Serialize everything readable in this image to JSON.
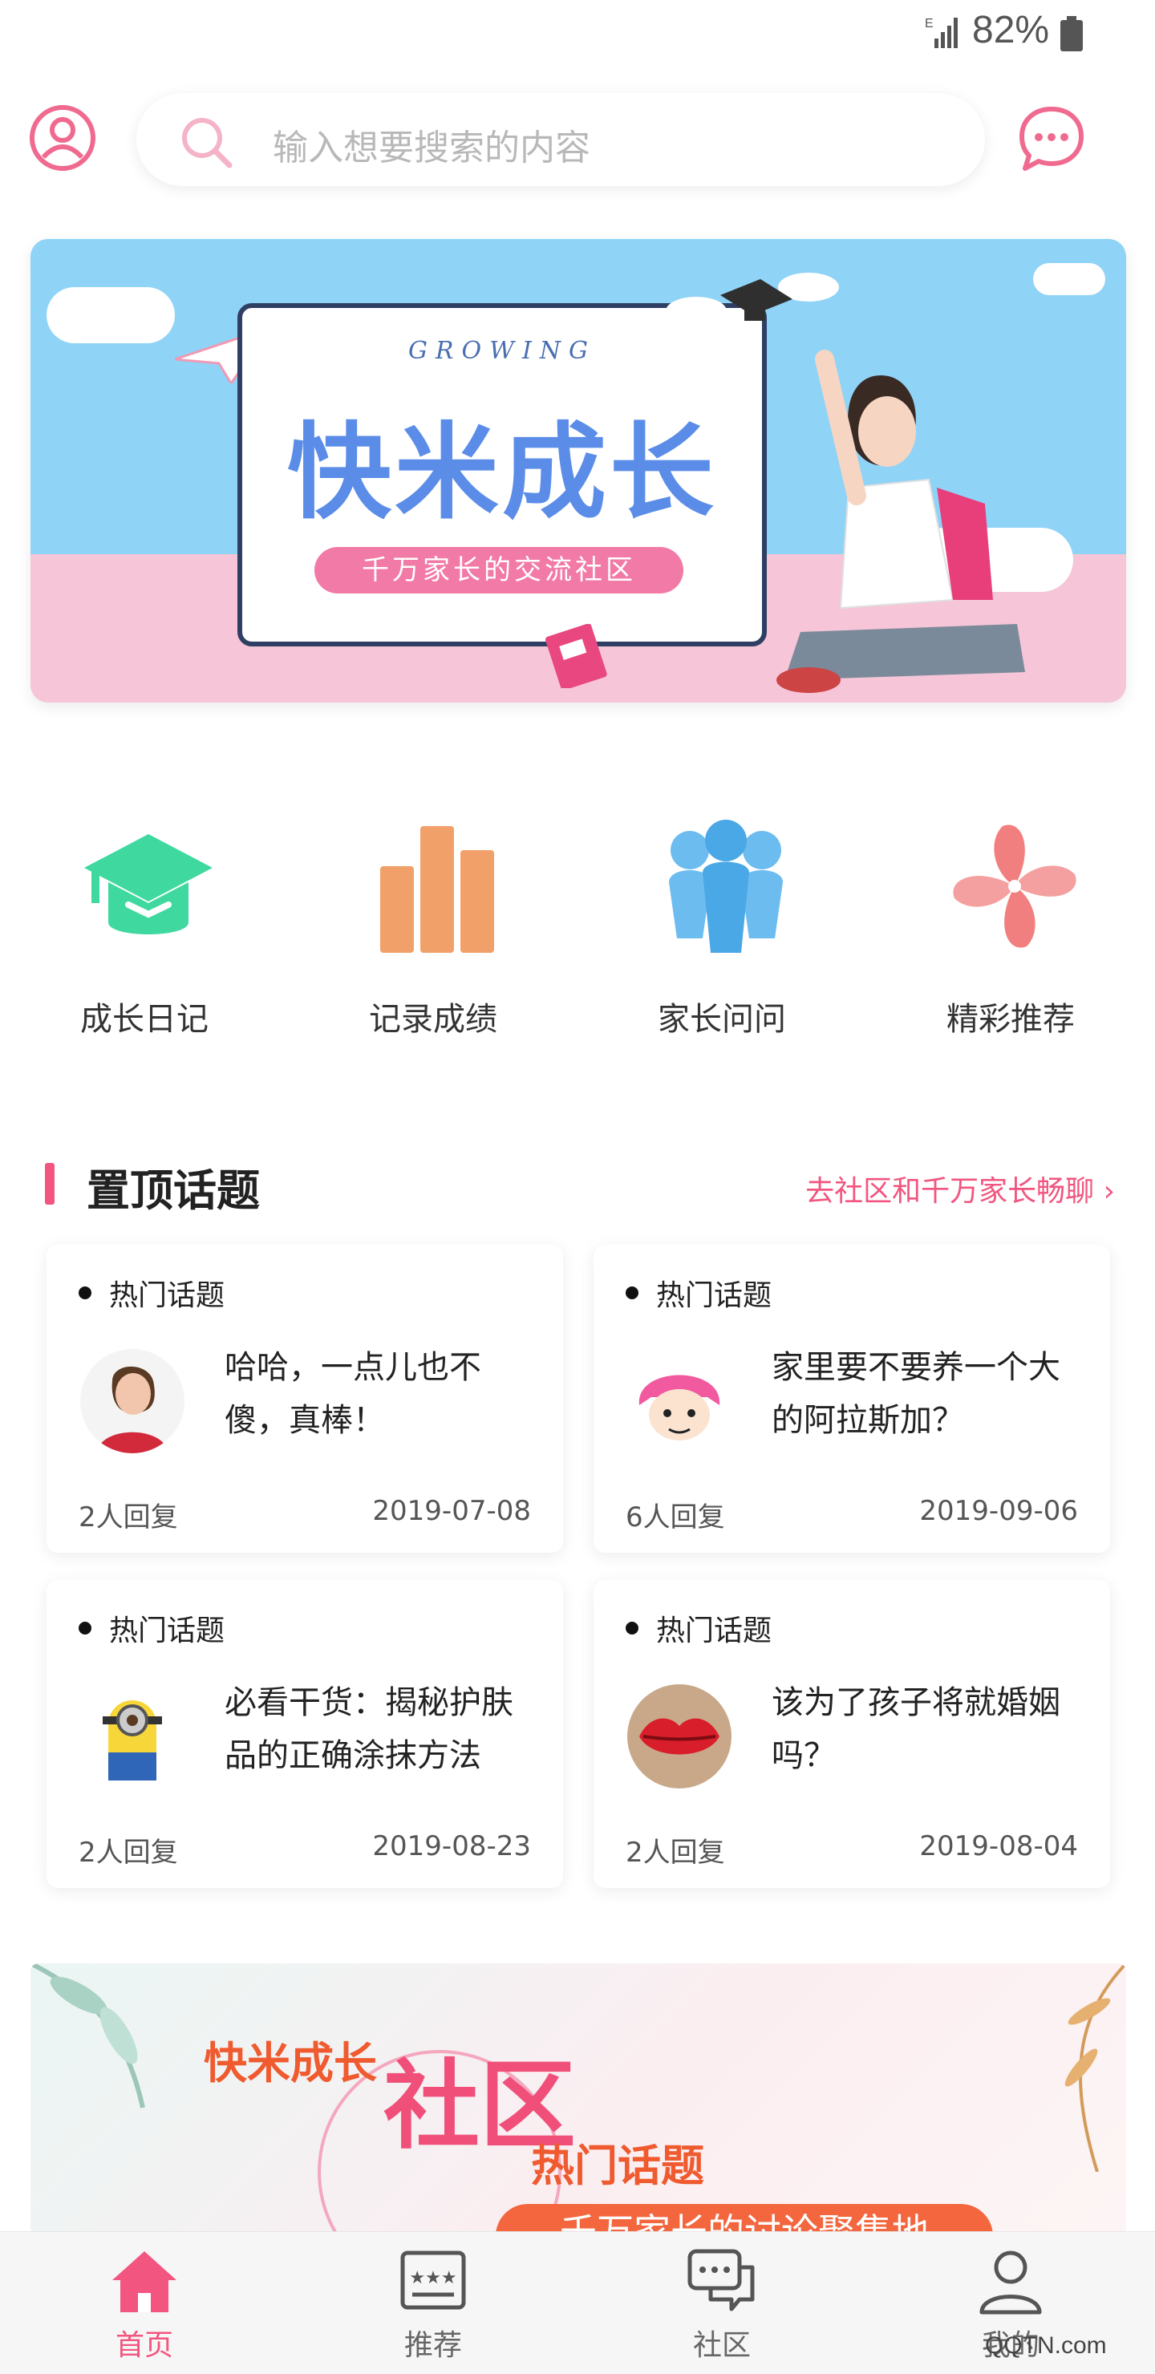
{
  "status": {
    "battery": "82%"
  },
  "search": {
    "placeholder": "输入想要搜索的内容"
  },
  "banner": {
    "subtitle": "GROWING",
    "title": "快米成长",
    "tagline": "千万家长的交流社区"
  },
  "entries": [
    {
      "label": "成长日记",
      "icon": "graduation-cap-icon",
      "color": "#3fd9a0"
    },
    {
      "label": "记录成绩",
      "icon": "bar-chart-icon",
      "color": "#f2a06a"
    },
    {
      "label": "家长问问",
      "icon": "people-icon",
      "color": "#4aa8e6"
    },
    {
      "label": "精彩推荐",
      "icon": "pinwheel-icon",
      "color": "#f27f7f"
    }
  ],
  "section": {
    "title": "置顶话题",
    "link": "去社区和千万家长畅聊"
  },
  "topics": [
    {
      "tag": "热门话题",
      "text": "哈哈，一点儿也不傻，真棒！",
      "replies": "2人回复",
      "date": "2019-07-08",
      "thumb": "woman-photo"
    },
    {
      "tag": "热门话题",
      "text": "家里要不要养一个大的阿拉斯加？",
      "replies": "6人回复",
      "date": "2019-09-06",
      "thumb": "pink-hair-cartoon"
    },
    {
      "tag": "热门话题",
      "text": "必看干货：揭秘护肤品的正确涂抹方法",
      "replies": "2人回复",
      "date": "2019-08-23",
      "thumb": "minion-cartoon"
    },
    {
      "tag": "热门话题",
      "text": "该为了孩子将就婚姻吗？",
      "replies": "2人回复",
      "date": "2019-08-04",
      "thumb": "red-lips-photo"
    }
  ],
  "promo": {
    "brand": "快米成长",
    "big": "社区",
    "headline": "热门话题",
    "sub": "千万家长的讨论聚集地"
  },
  "tabs": [
    {
      "label": "首页",
      "icon": "home-icon",
      "active": true
    },
    {
      "label": "推荐",
      "icon": "recommend-icon",
      "active": false
    },
    {
      "label": "社区",
      "icon": "community-chat-icon",
      "active": false
    },
    {
      "label": "我的",
      "icon": "profile-icon",
      "active": false
    }
  ],
  "watermark": "QQTN.com",
  "colors": {
    "accent": "#f2557f",
    "search_bg": "#ffffff"
  }
}
